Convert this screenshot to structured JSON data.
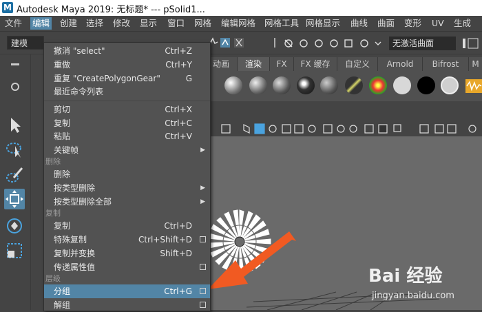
{
  "window": {
    "title": "Autodesk Maya 2019: 无标题*    ---    pSolid1..."
  },
  "menubar": {
    "items": [
      "文件",
      "编辑",
      "创建",
      "选择",
      "修改",
      "显示",
      "窗口",
      "网格",
      "编辑网格",
      "网格工具",
      "网格显示",
      "曲线",
      "曲面",
      "变形",
      "UV",
      "生成"
    ],
    "active_index": 1
  },
  "toolbar": {
    "mode_select": "建模",
    "status_field": "无激活曲面"
  },
  "shelf": {
    "tabs": [
      "动画",
      "渲染",
      "FX",
      "FX 缓存",
      "自定义",
      "Arnold",
      "Bifrost",
      "M"
    ],
    "active_tab": "渲染"
  },
  "edit_menu": {
    "items": [
      {
        "label": "撤消 \"select\"",
        "shortcut": "Ctrl+Z"
      },
      {
        "label": "重做",
        "shortcut": "Ctrl+Y"
      },
      {
        "label": "重复 \"CreatePolygonGear\"",
        "shortcut": "G"
      },
      {
        "label": "最近命令列表",
        "shortcut": ""
      },
      {
        "label": "剪切",
        "shortcut": "Ctrl+X"
      },
      {
        "label": "复制",
        "shortcut": "Ctrl+C"
      },
      {
        "label": "粘贴",
        "shortcut": "Ctrl+V"
      },
      {
        "label": "关键帧",
        "shortcut": ""
      },
      {
        "label": "删除",
        "shortcut": ""
      },
      {
        "label": "按类型删除",
        "shortcut": ""
      },
      {
        "label": "按类型删除全部",
        "shortcut": ""
      },
      {
        "label": "复制",
        "shortcut": "Ctrl+D"
      },
      {
        "label": "特殊复制",
        "shortcut": "Ctrl+Shift+D"
      },
      {
        "label": "复制并变换",
        "shortcut": "Shift+D"
      },
      {
        "label": "传递属性值",
        "shortcut": ""
      },
      {
        "label": "分组",
        "shortcut": "Ctrl+G"
      },
      {
        "label": "解组",
        "shortcut": ""
      }
    ],
    "sections": [
      "删除",
      "复制",
      "层级"
    ]
  },
  "watermark": {
    "logo": "Bai 经验",
    "url": "jingyan.baidu.com"
  }
}
